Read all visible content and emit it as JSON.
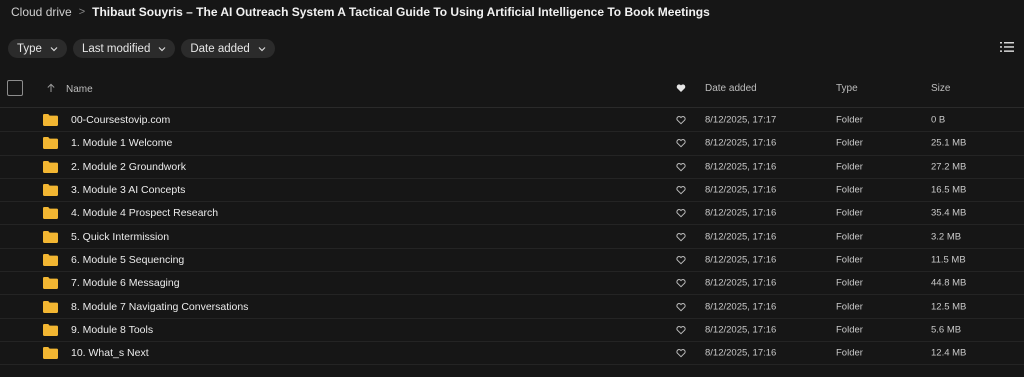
{
  "breadcrumb": {
    "root": "Cloud drive",
    "separator": ">",
    "current": "Thibaut Souyris – The AI Outreach System A Tactical Guide To Using Artificial Intelligence To Book Meetings"
  },
  "filters": [
    {
      "label": "Type"
    },
    {
      "label": "Last modified"
    },
    {
      "label": "Date added"
    }
  ],
  "columns": {
    "name": "Name",
    "date": "Date added",
    "type": "Type",
    "size": "Size"
  },
  "rows": [
    {
      "name": "00-Coursestovip.com",
      "date": "8/12/2025, 17:17",
      "type": "Folder",
      "size": "0 B"
    },
    {
      "name": "1. Module 1 Welcome",
      "date": "8/12/2025, 17:16",
      "type": "Folder",
      "size": "25.1 MB"
    },
    {
      "name": "2. Module 2 Groundwork",
      "date": "8/12/2025, 17:16",
      "type": "Folder",
      "size": "27.2 MB"
    },
    {
      "name": "3. Module 3 AI Concepts",
      "date": "8/12/2025, 17:16",
      "type": "Folder",
      "size": "16.5 MB"
    },
    {
      "name": "4. Module 4 Prospect Research",
      "date": "8/12/2025, 17:16",
      "type": "Folder",
      "size": "35.4 MB"
    },
    {
      "name": "5. Quick Intermission",
      "date": "8/12/2025, 17:16",
      "type": "Folder",
      "size": "3.2 MB"
    },
    {
      "name": "6. Module 5 Sequencing",
      "date": "8/12/2025, 17:16",
      "type": "Folder",
      "size": "11.5 MB"
    },
    {
      "name": "7. Module 6 Messaging",
      "date": "8/12/2025, 17:16",
      "type": "Folder",
      "size": "44.8 MB"
    },
    {
      "name": "8. Module 7 Navigating Conversations",
      "date": "8/12/2025, 17:16",
      "type": "Folder",
      "size": "12.5 MB"
    },
    {
      "name": "9. Module 8 Tools",
      "date": "8/12/2025, 17:16",
      "type": "Folder",
      "size": "5.6 MB"
    },
    {
      "name": "10. What_s Next",
      "date": "8/12/2025, 17:16",
      "type": "Folder",
      "size": "12.4 MB"
    }
  ],
  "icons": {
    "folder": "folder-icon",
    "favorite": "heart-icon",
    "sort": "arrow-up-icon",
    "view": "list-view-icon"
  },
  "colors": {
    "background": "#161616",
    "folder": "#f2b632",
    "chip": "#2b2b2b"
  }
}
